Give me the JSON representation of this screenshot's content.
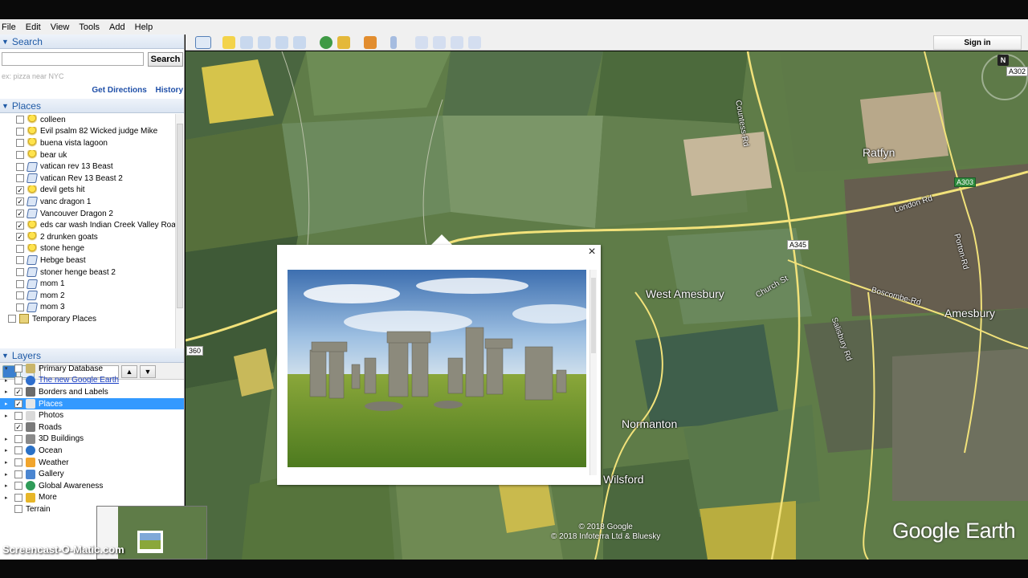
{
  "menu": {
    "items": [
      "File",
      "Edit",
      "View",
      "Tools",
      "Add",
      "Help"
    ]
  },
  "search": {
    "header": "Search",
    "button_label": "Search",
    "placeholder": "ex: pizza near NYC",
    "get_directions": "Get Directions",
    "history": "History"
  },
  "places": {
    "header": "Places",
    "items": [
      {
        "label": "colleen",
        "icon": "yellow-pin-icon",
        "checked": false
      },
      {
        "label": "Evil psalm 82 Wicked judge Mike",
        "icon": "yellow-pin-icon",
        "checked": false
      },
      {
        "label": "buena vista lagoon",
        "icon": "yellow-pin-icon",
        "checked": false
      },
      {
        "label": "bear uk",
        "icon": "yellow-pin-icon",
        "checked": false
      },
      {
        "label": "vatican rev 13 Beast",
        "icon": "path-icon",
        "checked": false
      },
      {
        "label": "vatican Rev 13 Beast 2",
        "icon": "path-icon",
        "checked": false
      },
      {
        "label": "devil gets hit",
        "icon": "yellow-pin-icon",
        "checked": true
      },
      {
        "label": "vanc dragon 1",
        "icon": "path-icon",
        "checked": true
      },
      {
        "label": "Vancouver Dragon 2",
        "icon": "path-icon",
        "checked": true
      },
      {
        "label": "eds car wash  Indian Creek Valley Road",
        "icon": "yellow-pin-icon",
        "checked": true
      },
      {
        "label": "2 drunken goats",
        "icon": "yellow-pin-icon",
        "checked": true
      },
      {
        "label": "stone henge",
        "icon": "yellow-pin-icon",
        "checked": false
      },
      {
        "label": "Hebge beast",
        "icon": "path-icon",
        "checked": false
      },
      {
        "label": "stoner henge beast 2",
        "icon": "path-icon",
        "checked": false
      },
      {
        "label": "mom 1",
        "icon": "path-icon",
        "checked": false
      },
      {
        "label": "mom 2",
        "icon": "path-icon",
        "checked": false
      },
      {
        "label": "mom 3",
        "icon": "path-icon",
        "checked": false
      }
    ],
    "temporary": "Temporary Places"
  },
  "layers": {
    "header": "Layers",
    "items": [
      {
        "label": "Primary Database",
        "checked": false,
        "expand": "▲",
        "icon": "database-icon"
      },
      {
        "label": "The new Google Earth",
        "checked": false,
        "expand": "▶",
        "icon": "globe-icon",
        "link": true
      },
      {
        "label": "Borders and Labels",
        "checked": true,
        "expand": "▶",
        "icon": "flag-icon"
      },
      {
        "label": "Places",
        "checked": true,
        "expand": "▶",
        "icon": "places-layer-icon",
        "selected": true
      },
      {
        "label": "Photos",
        "checked": false,
        "expand": "▶",
        "icon": "photos-icon"
      },
      {
        "label": "Roads",
        "checked": true,
        "expand": "",
        "icon": "roads-icon"
      },
      {
        "label": "3D Buildings",
        "checked": false,
        "expand": "▶",
        "icon": "buildings-icon"
      },
      {
        "label": "Ocean",
        "checked": false,
        "expand": "▶",
        "icon": "ocean-icon"
      },
      {
        "label": "Weather",
        "checked": false,
        "expand": "▶",
        "icon": "weather-icon"
      },
      {
        "label": "Gallery",
        "checked": false,
        "expand": "▶",
        "icon": "gallery-icon"
      },
      {
        "label": "Global Awareness",
        "checked": false,
        "expand": "▶",
        "icon": "awareness-icon"
      },
      {
        "label": "More",
        "checked": false,
        "expand": "▶",
        "icon": "more-icon"
      },
      {
        "label": "Terrain",
        "checked": false,
        "expand": "",
        "icon": ""
      }
    ]
  },
  "toolbar": {
    "sign_in": "Sign in"
  },
  "map": {
    "labels": {
      "ratfyn": "Ratfyn",
      "west_amesbury": "West Amesbury",
      "amesbury": "Amesbury",
      "normanton": "Normanton",
      "wilsford": "Wilsford",
      "countess_rd": "Countess-Rd",
      "london_rd": "London Rd",
      "church_st": "Church St",
      "boscombe_rd": "Boscombe-Rd",
      "salisbury_rd": "Salisbury Rd",
      "porton_rd": "Porton-Rd"
    },
    "road_shields": {
      "a302": "A302",
      "a303": "A303",
      "a345": "A345",
      "r360": "360"
    },
    "compass_n": "N",
    "copyright_1": "© 2018 Google",
    "copyright_2": "© 2018 Infoterra Ltd & Bluesky",
    "logo": "Google Earth"
  },
  "balloon": {
    "close": "×"
  },
  "watermark": "Screencast-O-Matic.com",
  "colors": {
    "accent_blue": "#1f5aa6",
    "selection": "#3399ff",
    "road_yellow": "#f2e27a"
  }
}
